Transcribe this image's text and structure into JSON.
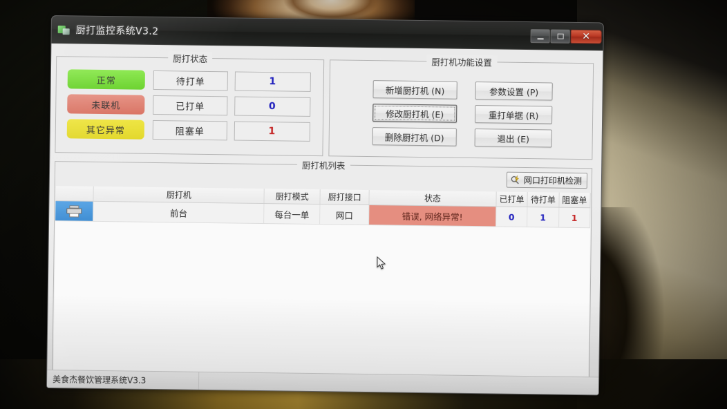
{
  "window": {
    "title": "厨打监控系统V3.2",
    "app_icon": "app-icon",
    "minimize_label": "",
    "maximize_label": "",
    "close_label": "✕"
  },
  "status_panel": {
    "title": "厨打状态",
    "legend": [
      {
        "label": "正常",
        "color": "#5fd818"
      },
      {
        "label": "未联机",
        "color": "#e46d5b"
      },
      {
        "label": "其它异常",
        "color": "#e8dc12"
      }
    ],
    "counters": [
      {
        "label": "待打单",
        "value": "1",
        "color": "#1b1bcd"
      },
      {
        "label": "已打单",
        "value": "0",
        "color": "#1b1bcd"
      },
      {
        "label": "阻塞单",
        "value": "1",
        "color": "#d32020"
      }
    ]
  },
  "function_panel": {
    "title": "厨打机功能设置",
    "buttons_left": [
      {
        "label": "新增厨打机 (N)",
        "focused": false
      },
      {
        "label": "修改厨打机 (E)",
        "focused": true
      },
      {
        "label": "删除厨打机 (D)",
        "focused": false
      }
    ],
    "buttons_right": [
      {
        "label": "参数设置 (P)",
        "focused": false
      },
      {
        "label": "重打单据 (R)",
        "focused": false
      },
      {
        "label": "退出 (E)",
        "focused": false
      }
    ]
  },
  "list_panel": {
    "title": "厨打机列表",
    "detect_button": "网口打印机检测",
    "detect_icon": "bolt-search-icon",
    "columns": [
      {
        "key": "icon",
        "label": ""
      },
      {
        "key": "name",
        "label": "厨打机"
      },
      {
        "key": "mode",
        "label": "厨打模式"
      },
      {
        "key": "port",
        "label": "厨打接口"
      },
      {
        "key": "status",
        "label": "状态"
      },
      {
        "key": "done",
        "label": "已打单"
      },
      {
        "key": "wait",
        "label": "待打单"
      },
      {
        "key": "block",
        "label": "阻塞单"
      }
    ],
    "rows": [
      {
        "icon": "printer-icon",
        "name": "前台",
        "mode": "每台一单",
        "port": "网口",
        "status": "错误, 网络异常!",
        "status_color": "#ef8d7d",
        "done": "0",
        "wait": "1",
        "block": "1"
      }
    ]
  },
  "statusbar": {
    "left": "美食杰餐饮管理系统V3.3",
    "right": ""
  }
}
